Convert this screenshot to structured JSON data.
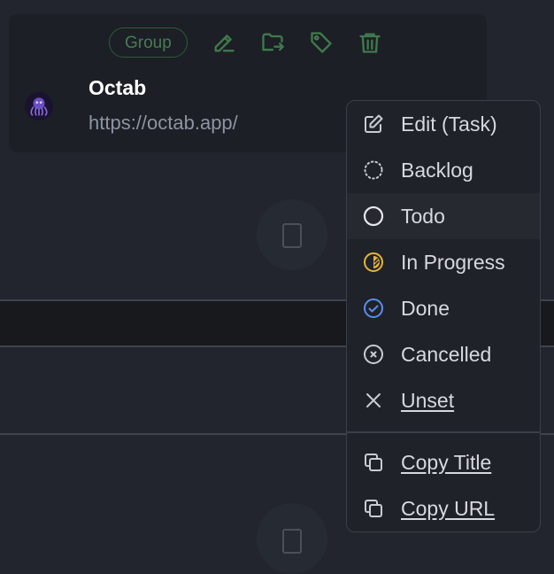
{
  "card": {
    "group_label": "Group",
    "title": "Octab",
    "url": "https://octab.app/"
  },
  "menu": {
    "items": [
      {
        "label": "Edit (Task)",
        "icon": "pencil-icon"
      },
      {
        "label": "Backlog",
        "icon": "dotted-circle-icon"
      },
      {
        "label": "Todo",
        "icon": "empty-circle-icon"
      },
      {
        "label": "In Progress",
        "icon": "half-circle-icon"
      },
      {
        "label": "Done",
        "icon": "check-circle-icon"
      },
      {
        "label": "Cancelled",
        "icon": "x-circle-icon"
      },
      {
        "label": "Unset",
        "icon": "x-icon"
      }
    ],
    "copy_items": [
      {
        "label": "Copy Title",
        "icon": "copy-icon"
      },
      {
        "label": "Copy URL",
        "icon": "copy-icon"
      }
    ]
  },
  "colors": {
    "accent_green": "#3f7a4c",
    "in_progress": "#e6b43a",
    "done": "#5b8dee"
  }
}
